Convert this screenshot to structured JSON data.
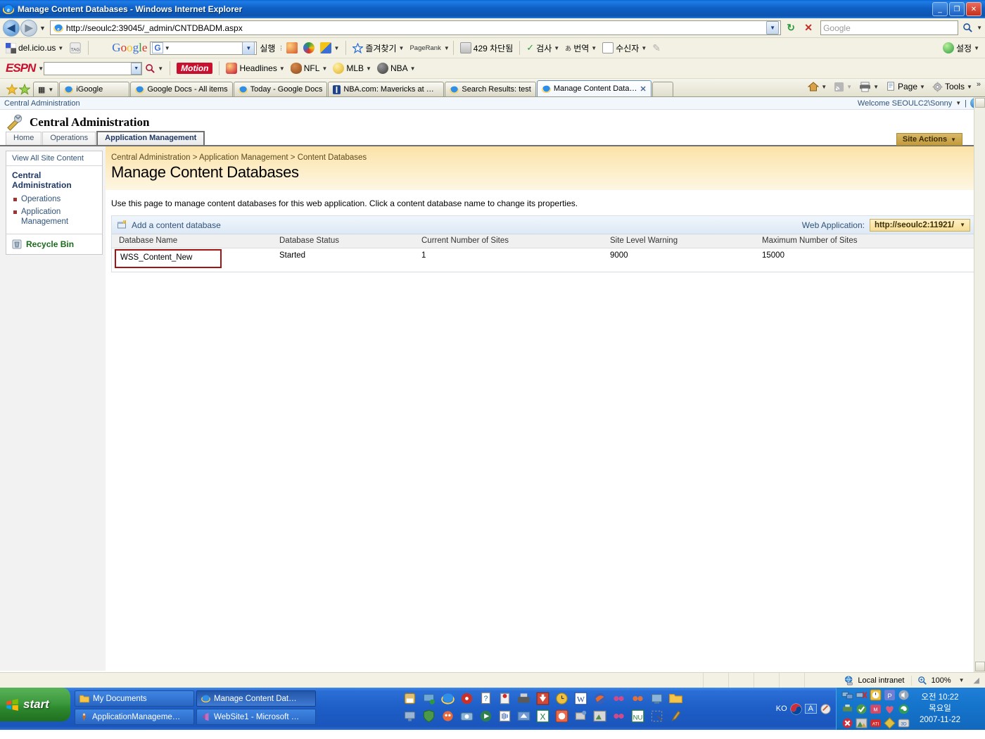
{
  "window": {
    "title": "Manage Content Databases - Windows Internet Explorer",
    "minimize_label": "_",
    "maximize_label": "❐",
    "close_label": "✕"
  },
  "addressbar": {
    "back_label": "◀",
    "forward_label": "▶",
    "dropdown_label": "▼",
    "url": "http://seoulc2:39045/_admin/CNTDBADM.aspx",
    "refresh_label": "↻",
    "stop_label": "✕",
    "search_placeholder": "Google",
    "search_value": "",
    "search_go_label": "🔍"
  },
  "toolbar_row1": {
    "delicious_label": "del.icio.us",
    "tag_label": "TAG",
    "google_label": "Google",
    "google_g": "G",
    "google_query": "",
    "run_label": "실행",
    "favorites_label": "즐겨찾기",
    "pagerank_label": "PageRank",
    "blocked_count_label": "429 차단됨",
    "check_label": "검사",
    "translate_label": "번역",
    "recipient_label": "수신자",
    "settings_label": "설정"
  },
  "toolbar_row2": {
    "espn_label": "ESPN",
    "espn_query": "",
    "motion_label": "Motion",
    "headlines_label": "Headlines",
    "nfl_label": "NFL",
    "mlb_label": "MLB",
    "nba_label": "NBA"
  },
  "tabs": {
    "quicktab_label": "▦",
    "quicktab_caret": "▼",
    "items": [
      {
        "label": "iGoogle",
        "active": false
      },
      {
        "label": "Google Docs - All items",
        "active": false
      },
      {
        "label": "Today - Google Docs",
        "active": false
      },
      {
        "label": "NBA.com: Mavericks at R…",
        "active": false
      },
      {
        "label": "Search Results: test",
        "active": false
      },
      {
        "label": "Manage Content Data…",
        "active": true
      }
    ],
    "close_label": "✕",
    "right_buttons": {
      "home_label": "⌂",
      "feeds_label": "◉",
      "print_label": "🖨",
      "page_label": "Page",
      "tools_label": "Tools",
      "overflow_label": "»"
    }
  },
  "sharepoint": {
    "top_site_label": "Central Administration",
    "welcome_text": "Welcome SEOULC2\\Sonny",
    "welcome_caret": "▼",
    "welcome_divider": "|",
    "help_label": "?",
    "site_title": "Central Administration",
    "nav_tabs": [
      {
        "label": "Home",
        "active": false
      },
      {
        "label": "Operations",
        "active": false
      },
      {
        "label": "Application Management",
        "active": true
      }
    ],
    "site_actions_label": "Site Actions",
    "site_actions_caret": "▼",
    "breadcrumb": {
      "parts": [
        "Central Administration",
        "Application Management",
        "Content Databases"
      ],
      "separator": ">"
    },
    "page_title": "Manage Content Databases",
    "description": "Use this page to manage content databases for this web application. Click a content database name to change its properties.",
    "left_nav": {
      "view_all_site_content": "View All Site Content",
      "heading": "Central Administration",
      "items": [
        {
          "label": "Operations"
        },
        {
          "label": "Application Management"
        }
      ],
      "recycle_bin": "Recycle Bin"
    },
    "grid": {
      "add_label": "Add a content database",
      "web_application_label": "Web Application:",
      "web_application_value": "http://seoulc2:11921/",
      "web_application_caret": "▼",
      "columns": [
        "Database Name",
        "Database Status",
        "Current Number of Sites",
        "Site Level Warning",
        "Maximum Number of Sites"
      ],
      "rows": [
        {
          "name": "WSS_Content_New",
          "status": "Started",
          "current_sites": "1",
          "site_level_warning": "9000",
          "max_sites": "15000"
        }
      ]
    }
  },
  "statusbar": {
    "zone_label": "Local intranet",
    "zoom_label": "100%",
    "zoom_caret": "▼"
  },
  "taskbar": {
    "start_label": "start",
    "tasks": [
      {
        "label": "My Documents",
        "active": false
      },
      {
        "label": "Manage Content Dat…",
        "active": true
      },
      {
        "label": "WebSite1 - Microsoft …",
        "active": false
      },
      {
        "label": "ApplicationManageme…",
        "active": false
      }
    ],
    "language_label": "KO",
    "ime_label": "A",
    "clock_time": "오전 10:22",
    "clock_day": "목요일",
    "clock_date": "2007-11-22"
  },
  "colors": {
    "title_blue": "#0d55b0",
    "sharepoint_gold": "#fbe2a7",
    "sharepoint_navy": "#1f3864",
    "link_blue": "#31537a",
    "highlight_red": "#a01414",
    "taskbar_blue": "#1e5fc8",
    "start_green": "#2e8a2e"
  }
}
